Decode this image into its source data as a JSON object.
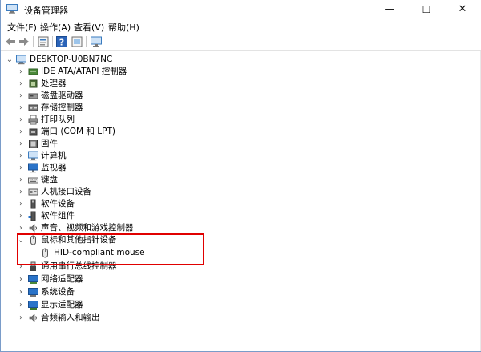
{
  "window": {
    "title": "设备管理器",
    "controls": {
      "minimize": "—",
      "maximize": "☐",
      "close": "✕"
    }
  },
  "menu": [
    {
      "label": "文件(F)"
    },
    {
      "label": "操作(A)"
    },
    {
      "label": "查看(V)"
    },
    {
      "label": "帮助(H)"
    }
  ],
  "toolbar": {
    "buttons": [
      "back-arrow-icon",
      "forward-arrow-icon",
      "properties-icon",
      "help-icon",
      "update-driver-icon",
      "monitor-scan-icon"
    ]
  },
  "tree": {
    "root": {
      "label": "DESKTOP-U0BN7NC",
      "expanded": true
    },
    "items": [
      {
        "label": "IDE ATA/ATAPI 控制器",
        "icon": "ide-controller-icon",
        "expanded": false
      },
      {
        "label": "处理器",
        "icon": "processor-icon",
        "expanded": false
      },
      {
        "label": "磁盘驱动器",
        "icon": "disk-drive-icon",
        "expanded": false
      },
      {
        "label": "存储控制器",
        "icon": "storage-controller-icon",
        "expanded": false
      },
      {
        "label": "打印队列",
        "icon": "printer-icon",
        "expanded": false
      },
      {
        "label": "端口 (COM 和 LPT)",
        "icon": "port-icon",
        "expanded": false
      },
      {
        "label": "固件",
        "icon": "firmware-icon",
        "expanded": false
      },
      {
        "label": "计算机",
        "icon": "computer-icon",
        "expanded": false
      },
      {
        "label": "监视器",
        "icon": "monitor-icon",
        "expanded": false
      },
      {
        "label": "键盘",
        "icon": "keyboard-icon",
        "expanded": false
      },
      {
        "label": "人机接口设备",
        "icon": "hid-icon",
        "expanded": false
      },
      {
        "label": "软件设备",
        "icon": "software-device-icon",
        "expanded": false
      },
      {
        "label": "软件组件",
        "icon": "software-component-icon",
        "expanded": false
      },
      {
        "label": "声音、视频和游戏控制器",
        "icon": "sound-icon",
        "expanded": false
      },
      {
        "label": "鼠标和其他指针设备",
        "icon": "mouse-icon",
        "expanded": true,
        "children": [
          {
            "label": "HID-compliant mouse",
            "icon": "mouse-icon"
          }
        ]
      },
      {
        "label": "通用串行总线控制器",
        "icon": "usb-icon",
        "expanded": false
      },
      {
        "label": "网络适配器",
        "icon": "network-adapter-icon",
        "expanded": false
      },
      {
        "label": "系统设备",
        "icon": "system-device-icon",
        "expanded": false
      },
      {
        "label": "显示适配器",
        "icon": "display-adapter-icon",
        "expanded": false
      },
      {
        "label": "音频输入和输出",
        "icon": "audio-io-icon",
        "expanded": false
      }
    ]
  },
  "colors": {
    "highlight_border": "#e00000",
    "icon_blue": "#2a73c8"
  }
}
